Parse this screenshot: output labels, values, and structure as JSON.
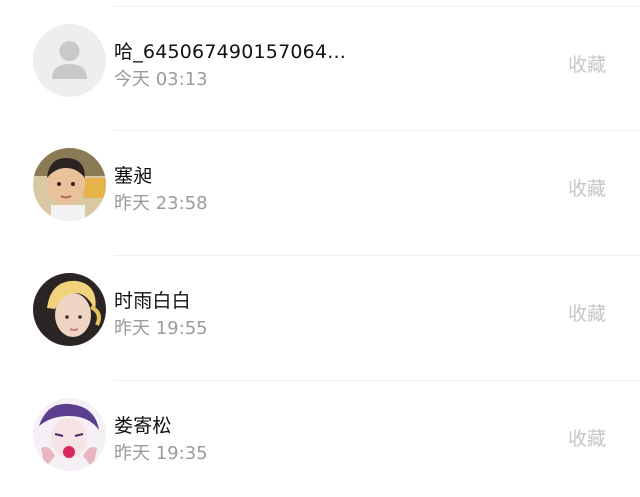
{
  "contacts": [
    {
      "name": "哈_645067490157064...",
      "time": "今天 03:13",
      "action": "收藏",
      "avatar": "default-user-icon"
    },
    {
      "name": "塞昶",
      "time": "昨天 23:58",
      "action": "收藏",
      "avatar": "child-photo"
    },
    {
      "name": "时雨白白",
      "time": "昨天 19:55",
      "action": "收藏",
      "avatar": "blond-hair-photo"
    },
    {
      "name": "娄寄松",
      "time": "昨天 19:35",
      "action": "收藏",
      "avatar": "anime-character-photo"
    }
  ],
  "colors": {
    "name": "#111111",
    "time": "#9b9b9b",
    "action": "#c7c7c7",
    "divider": "#efefef"
  }
}
